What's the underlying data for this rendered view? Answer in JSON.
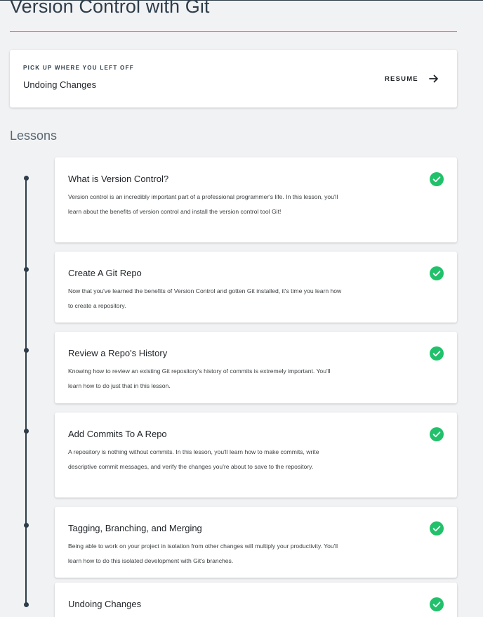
{
  "page": {
    "title": "Version Control with Git"
  },
  "resume": {
    "eyebrow": "PICK UP WHERE YOU LEFT OFF",
    "lesson": "Undoing Changes",
    "button_label": "RESUME",
    "button_icon": "arrow-right-icon"
  },
  "lessons_heading": "Lessons",
  "colors": {
    "accent_rule": "#18b8aa",
    "complete_green": "#21c16b",
    "timeline": "#2e3d49"
  },
  "lessons": [
    {
      "title": "What is Version Control?",
      "description": "Version control is an incredibly important part of a professional programmer's life. In this lesson, you'll learn about the benefits of version control and install the version control tool Git!",
      "status_icon": "check-circle-icon"
    },
    {
      "title": "Create A Git Repo",
      "description": "Now that you've learned the benefits of Version Control and gotten Git installed, it's time you learn how to create a repository.",
      "status_icon": "check-circle-icon"
    },
    {
      "title": "Review a Repo's History",
      "description": "Knowing how to review an existing Git repository's history of commits is extremely important. You'll learn how to do just that in this lesson.",
      "status_icon": "check-circle-icon"
    },
    {
      "title": "Add Commits To A Repo",
      "description": "A repository is nothing without commits. In this lesson, you'll learn how to make commits, write descriptive commit messages, and verify the changes you're about to save to the repository.",
      "status_icon": "check-circle-icon"
    },
    {
      "title": "Tagging, Branching, and Merging",
      "description": "Being able to work on your project in isolation from other changes will multiply your productivity. You'll learn how to do this isolated development with Git's branches.",
      "status_icon": "check-circle-icon"
    },
    {
      "title": "Undoing Changes",
      "description": "",
      "status_icon": "check-circle-icon"
    }
  ]
}
